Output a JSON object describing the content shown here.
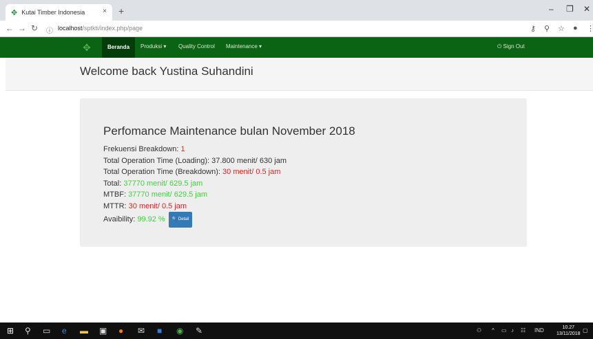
{
  "browser": {
    "tab_title": "Kutai Timber Indonesia",
    "tab_close": "×",
    "new_tab": "+",
    "url_host": "localhost",
    "url_path": "/sptkti/index.php/page"
  },
  "navbar": {
    "items": [
      "Beranda",
      "Produksi ▾",
      "Quality Control",
      "Maintenance ▾"
    ],
    "signout": "⏻ Sign Out",
    "brand_color": "#0b6414"
  },
  "welcome": "Welcome back Yustina Suhandini",
  "panel": {
    "title": "Perfomance Maintenance bulan November 2018",
    "rows": [
      {
        "label": "Frekuensi Breakdown: ",
        "value": "1",
        "tone": "red"
      },
      {
        "label": "Total Operation Time (Loading): ",
        "value": "37.800 menit/ 630 jam",
        "tone": "plain"
      },
      {
        "label": "Total Operation Time (Breakdown): ",
        "value": "30 menit/ 0.5 jam",
        "tone": "red"
      },
      {
        "label": "Total: ",
        "value": "37770 menit/ 629.5 jam",
        "tone": "green"
      },
      {
        "label": "MTBF: ",
        "value": "37770 menit/ 629.5 jam",
        "tone": "green"
      },
      {
        "label": "MTTR: ",
        "value": "30 menit/ 0.5 jam",
        "tone": "red"
      },
      {
        "label": "Avaibility: ",
        "value": "99.92 %",
        "tone": "green"
      }
    ],
    "detail_button": "🔍 Detail"
  },
  "taskbar": {
    "lang": "IND",
    "time": "10.27",
    "date": "13/11/2018"
  }
}
